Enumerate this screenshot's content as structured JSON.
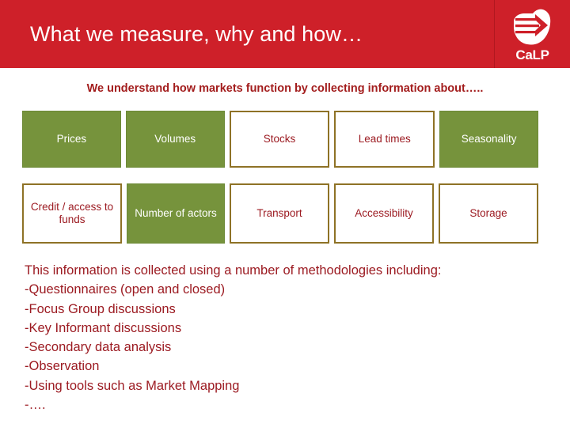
{
  "header": {
    "title": "What we measure, why and how…",
    "band_color": "#ce2029",
    "logo": {
      "name": "calp-hand-arrow-logo",
      "wordmark": "CaLP"
    }
  },
  "subtitle": {
    "text": "We understand how markets function by collecting information about…..",
    "color": "#a31d1d"
  },
  "grid": {
    "green_color": "#76933c",
    "white_border_color": "#8e7226",
    "white_text_color": "#9c1b22",
    "rows": [
      {
        "cells": [
          {
            "label": "Prices",
            "style": "green"
          },
          {
            "label": "Volumes",
            "style": "green"
          },
          {
            "label": "Stocks",
            "style": "white"
          },
          {
            "label": "Lead times",
            "style": "white"
          },
          {
            "label": "Seasonality",
            "style": "green"
          }
        ]
      },
      {
        "cells": [
          {
            "label": "Credit / access to funds",
            "style": "white"
          },
          {
            "label": "Number of actors",
            "style": "green"
          },
          {
            "label": "Transport",
            "style": "white"
          },
          {
            "label": "Accessibility",
            "style": "white"
          },
          {
            "label": "Storage",
            "style": "white"
          }
        ]
      }
    ]
  },
  "methods": {
    "intro": "This information is collected using a number of methodologies including:",
    "items": [
      "-Questionnaires (open and closed)",
      "-Focus Group discussions",
      "-Key Informant discussions",
      "-Secondary data analysis",
      "-Observation",
      "-Using tools such as Market Mapping",
      "-…."
    ]
  }
}
